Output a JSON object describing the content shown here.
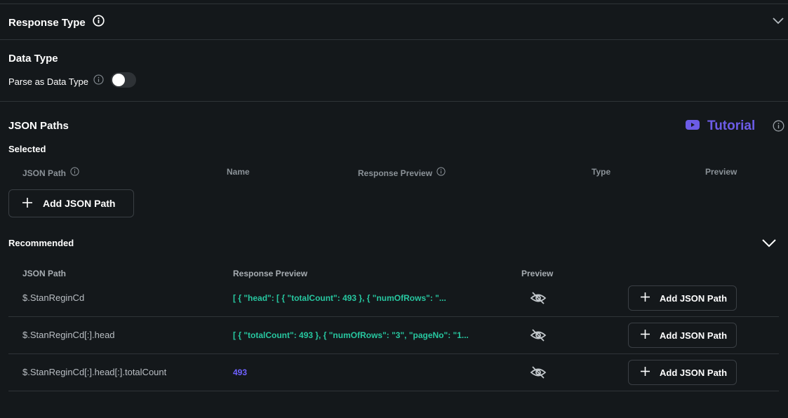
{
  "response_type": {
    "title": "Response Type"
  },
  "data_type": {
    "title": "Data Type",
    "parse_label": "Parse as Data Type",
    "parse_enabled": false
  },
  "json_paths": {
    "title": "JSON Paths",
    "tutorial_label": "Tutorial",
    "selected": {
      "title": "Selected",
      "columns": [
        "JSON Path",
        "Name",
        "Response Preview",
        "Type",
        "Preview"
      ],
      "add_button_label": "Add JSON Path"
    },
    "recommended": {
      "title": "Recommended",
      "columns": [
        "JSON Path",
        "Response Preview",
        "Preview"
      ],
      "rows": [
        {
          "path": "$.StanReginCd",
          "preview": "[ {   \"head\": [   {     \"totalCount\": 493   },   {     \"numOfRows\": \"...",
          "button_label": "Add JSON Path"
        },
        {
          "path": "$.StanReginCd[:].head",
          "preview": "[ {   \"totalCount\": 493 }, {   \"numOfRows\": \"3\",   \"pageNo\": \"1...",
          "button_label": "Add JSON Path"
        },
        {
          "path": "$.StanReginCd[:].head[:].totalCount",
          "preview": "493",
          "button_label": "Add JSON Path"
        }
      ]
    }
  },
  "colors": {
    "background": "#14181b",
    "accent_tutorial": "#6c5ce7",
    "json_preview": "#27c7a0",
    "number_preview": "#6f61ff"
  }
}
